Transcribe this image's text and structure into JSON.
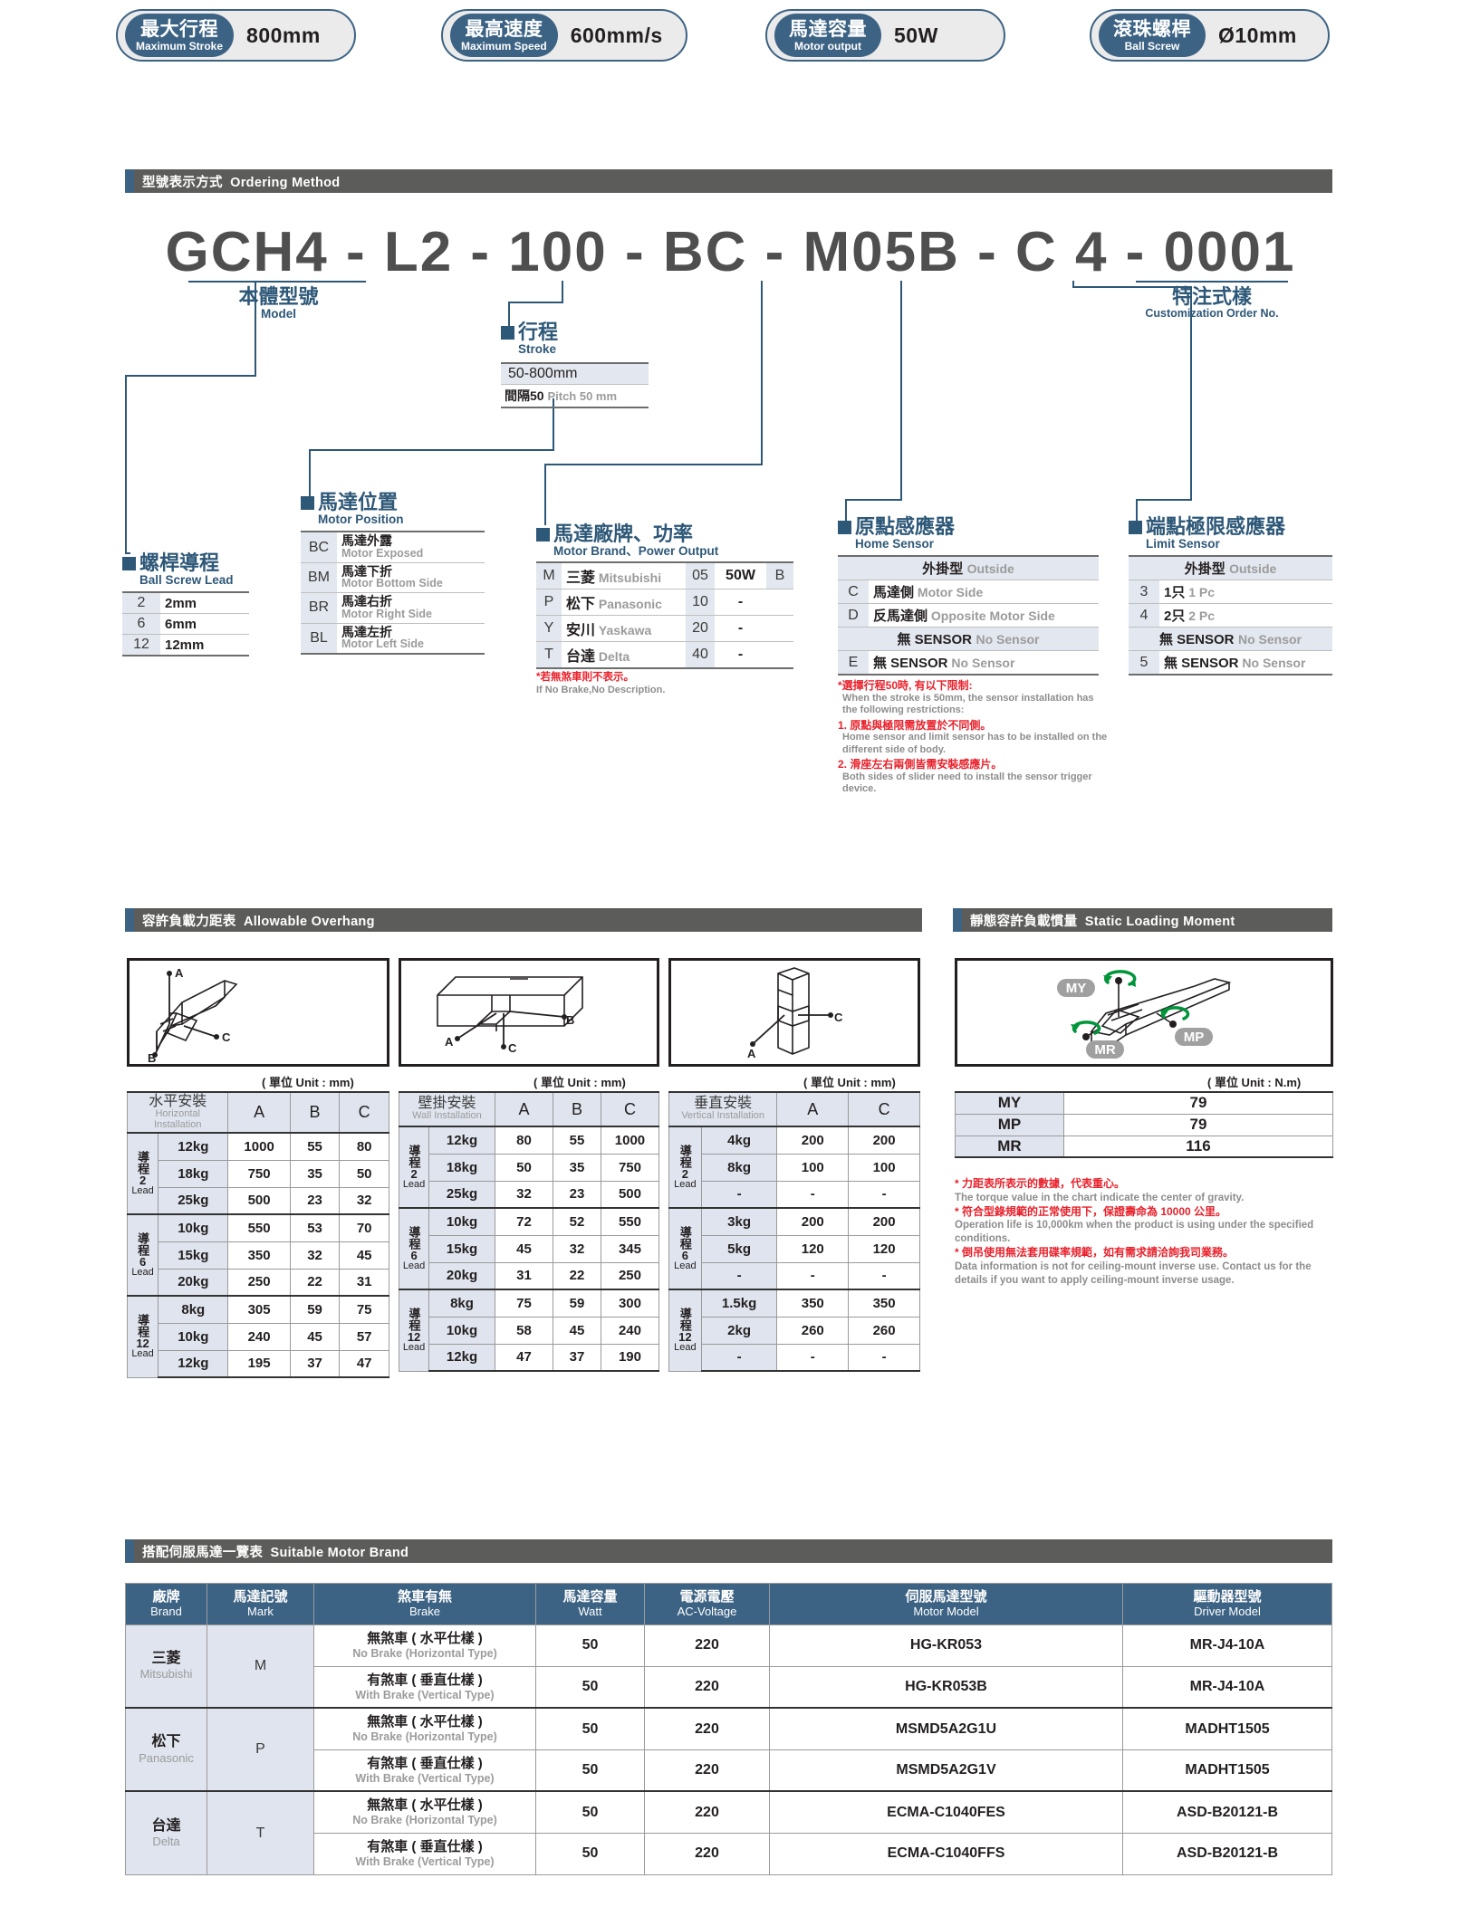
{
  "badges": [
    {
      "cn": "最大行程",
      "en": "Maximum Stroke",
      "value": "800mm"
    },
    {
      "cn": "最高速度",
      "en": "Maximum Speed",
      "value": "600mm/s"
    },
    {
      "cn": "馬達容量",
      "en": "Motor output",
      "value": "50W"
    },
    {
      "cn": "滾珠螺桿",
      "en": "Ball Screw",
      "value": "Ø10mm"
    }
  ],
  "sections": {
    "ordering": {
      "cn": "型號表示方式",
      "en": "Ordering Method"
    },
    "overhang": {
      "cn": "容許負載力距表",
      "en": "Allowable Overhang"
    },
    "moment": {
      "cn": "靜態容許負載慣量",
      "en": "Static Loading Moment"
    },
    "motorbrand": {
      "cn": "搭配伺服馬達一覽表",
      "en": "Suitable Motor Brand"
    }
  },
  "order_code": "GCH4 - L2 - 100 - BC - M05B - C 4 - 0001",
  "callouts": {
    "model": {
      "cn": "本體型號",
      "en": "Model"
    },
    "custom": {
      "cn": "特注式樣",
      "en": "Customization Order No."
    },
    "lead": {
      "cn": "螺桿導程",
      "en": "Ball Screw Lead",
      "rows": [
        [
          "2",
          "2mm"
        ],
        [
          "6",
          "6mm"
        ],
        [
          "12",
          "12mm"
        ]
      ]
    },
    "motor_position": {
      "cn": "馬達位置",
      "en": "Motor Position",
      "rows": [
        {
          "key": "BC",
          "cn": "馬達外露",
          "en": "Motor Exposed"
        },
        {
          "key": "BM",
          "cn": "馬達下折",
          "en": "Motor Bottom Side"
        },
        {
          "key": "BR",
          "cn": "馬達右折",
          "en": "Motor Right Side"
        },
        {
          "key": "BL",
          "cn": "馬達左折",
          "en": "Motor Left Side"
        }
      ]
    },
    "stroke": {
      "cn": "行程",
      "en": "Stroke",
      "range": "50-800mm",
      "pitch_cn": "間隔50",
      "pitch_en": "Pitch 50 mm"
    },
    "motor_brand": {
      "cn": "馬達廠牌、功率",
      "en": "Motor Brand、Power Output",
      "rows": [
        {
          "mark": "M",
          "cn": "三菱",
          "en": "Mitsubishi",
          "code": "05",
          "watt": "50W",
          "brake": "B"
        },
        {
          "mark": "P",
          "cn": "松下",
          "en": "Panasonic",
          "code": "10",
          "watt": "-",
          "brake": ""
        },
        {
          "mark": "Y",
          "cn": "安川",
          "en": "Yaskawa",
          "code": "20",
          "watt": "-",
          "brake": ""
        },
        {
          "mark": "T",
          "cn": "台達",
          "en": "Delta",
          "code": "40",
          "watt": "-",
          "brake": ""
        }
      ],
      "note_cn": "*若無煞車則不表示。",
      "note_en": "If No Brake,No Description."
    },
    "home_sensor": {
      "cn": "原點感應器",
      "en": "Home Sensor",
      "group1_cn": "外掛型",
      "group1_en": "Outside",
      "rows": [
        {
          "key": "C",
          "cn": "馬達側",
          "en": "Motor Side"
        },
        {
          "key": "D",
          "cn": "反馬達側",
          "en": "Opposite Motor Side"
        }
      ],
      "group2_cn": "無 SENSOR",
      "group2_en": "No Sensor",
      "rows2": [
        {
          "key": "E",
          "cn": "無 SENSOR",
          "en": "No Sensor"
        }
      ],
      "notes": [
        {
          "cn": "*選擇行程50時, 有以下限制:",
          "en": "When the stroke is 50mm, the sensor installation has the following restrictions:"
        },
        {
          "cn": "1. 原點與極限需放置於不同側。",
          "en": "Home sensor and limit sensor has to be installed on the different side of body."
        },
        {
          "cn": "2. 滑座左右兩側皆需安裝感應片。",
          "en": "Both sides of slider need to install the sensor trigger device."
        }
      ]
    },
    "limit_sensor": {
      "cn": "端點極限感應器",
      "en": "Limit Sensor",
      "group1_cn": "外掛型",
      "group1_en": "Outside",
      "rows": [
        {
          "key": "3",
          "cn": "1只",
          "en": "1 Pc"
        },
        {
          "key": "4",
          "cn": "2只",
          "en": "2 Pc"
        }
      ],
      "group2_cn": "無 SENSOR",
      "group2_en": "No Sensor",
      "rows2": [
        {
          "key": "5",
          "cn": "無 SENSOR",
          "en": "No Sensor"
        }
      ]
    }
  },
  "overhang": {
    "unit_mm": "( 單位 Unit : mm)",
    "unit_nm": "( 單位 Unit : N.m)",
    "diagram_labels": [
      "A",
      "B",
      "C"
    ],
    "tables": [
      {
        "cn": "水平安裝",
        "en": "Horizontal Installation",
        "cols": [
          "A",
          "B",
          "C"
        ],
        "groups": [
          {
            "lead_cn": "導程",
            "lead_num": "2",
            "lead_en": "Lead",
            "rows": [
              [
                "12kg",
                "1000",
                "55",
                "80"
              ],
              [
                "18kg",
                "750",
                "35",
                "50"
              ],
              [
                "25kg",
                "500",
                "23",
                "32"
              ]
            ]
          },
          {
            "lead_cn": "導程",
            "lead_num": "6",
            "lead_en": "Lead",
            "rows": [
              [
                "10kg",
                "550",
                "53",
                "70"
              ],
              [
                "15kg",
                "350",
                "32",
                "45"
              ],
              [
                "20kg",
                "250",
                "22",
                "31"
              ]
            ]
          },
          {
            "lead_cn": "導程",
            "lead_num": "12",
            "lead_en": "Lead",
            "rows": [
              [
                "8kg",
                "305",
                "59",
                "75"
              ],
              [
                "10kg",
                "240",
                "45",
                "57"
              ],
              [
                "12kg",
                "195",
                "37",
                "47"
              ]
            ]
          }
        ]
      },
      {
        "cn": "壁掛安裝",
        "en": "Wall Installation",
        "cols": [
          "A",
          "B",
          "C"
        ],
        "groups": [
          {
            "lead_cn": "導程",
            "lead_num": "2",
            "lead_en": "Lead",
            "rows": [
              [
                "12kg",
                "80",
                "55",
                "1000"
              ],
              [
                "18kg",
                "50",
                "35",
                "750"
              ],
              [
                "25kg",
                "32",
                "23",
                "500"
              ]
            ]
          },
          {
            "lead_cn": "導程",
            "lead_num": "6",
            "lead_en": "Lead",
            "rows": [
              [
                "10kg",
                "72",
                "52",
                "550"
              ],
              [
                "15kg",
                "45",
                "32",
                "345"
              ],
              [
                "20kg",
                "31",
                "22",
                "250"
              ]
            ]
          },
          {
            "lead_cn": "導程",
            "lead_num": "12",
            "lead_en": "Lead",
            "rows": [
              [
                "8kg",
                "75",
                "59",
                "300"
              ],
              [
                "10kg",
                "58",
                "45",
                "240"
              ],
              [
                "12kg",
                "47",
                "37",
                "190"
              ]
            ]
          }
        ]
      },
      {
        "cn": "垂直安裝",
        "en": "Vertical Installation",
        "cols": [
          "A",
          "C"
        ],
        "groups": [
          {
            "lead_cn": "導程",
            "lead_num": "2",
            "lead_en": "Lead",
            "rows": [
              [
                "4kg",
                "200",
                "200"
              ],
              [
                "8kg",
                "100",
                "100"
              ],
              [
                "-",
                "-",
                "-"
              ]
            ]
          },
          {
            "lead_cn": "導程",
            "lead_num": "6",
            "lead_en": "Lead",
            "rows": [
              [
                "3kg",
                "200",
                "200"
              ],
              [
                "5kg",
                "120",
                "120"
              ],
              [
                "-",
                "-",
                "-"
              ]
            ]
          },
          {
            "lead_cn": "導程",
            "lead_num": "12",
            "lead_en": "Lead",
            "rows": [
              [
                "1.5kg",
                "350",
                "350"
              ],
              [
                "2kg",
                "260",
                "260"
              ],
              [
                "-",
                "-",
                "-"
              ]
            ]
          }
        ]
      }
    ]
  },
  "moment": {
    "diagram_labels": [
      "MY",
      "MP",
      "MR"
    ],
    "rows": [
      [
        "MY",
        "79"
      ],
      [
        "MP",
        "79"
      ],
      [
        "MR",
        "116"
      ]
    ],
    "notes": [
      {
        "cn": "* 力距表所表示的數據，代表重心。",
        "en": "The torque value in the chart indicate the center of gravity."
      },
      {
        "cn": "* 符合型錄規範的正常使用下，保證壽命為 10000 公里。",
        "en": "Operation life is 10,000km when the product is using under the specified conditions."
      },
      {
        "cn": "* 倒吊使用無法套用碟率規範，如有需求請洽詢我司業務。",
        "en": "Data information is not for ceiling-mount inverse use. Contact us for the details if you want to apply ceiling-mount inverse usage."
      }
    ]
  },
  "motor_table": {
    "headers": [
      {
        "cn": "廠牌",
        "en": "Brand"
      },
      {
        "cn": "馬達記號",
        "en": "Mark"
      },
      {
        "cn": "煞車有無",
        "en": "Brake"
      },
      {
        "cn": "馬達容量",
        "en": "Watt"
      },
      {
        "cn": "電源電壓",
        "en": "AC-Voltage"
      },
      {
        "cn": "伺服馬達型號",
        "en": "Motor Model"
      },
      {
        "cn": "驅動器型號",
        "en": "Driver Model"
      }
    ],
    "brands": [
      {
        "cn": "三菱",
        "en": "Mitsubishi",
        "mark": "M",
        "rows": [
          {
            "brake_cn": "無煞車 ( 水平仕樣 )",
            "brake_en": "No Brake (Horizontal Type)",
            "watt": "50",
            "volt": "220",
            "motor": "HG-KR053",
            "driver": "MR-J4-10A"
          },
          {
            "brake_cn": "有煞車 ( 垂直仕樣 )",
            "brake_en": "With Brake (Vertical Type)",
            "watt": "50",
            "volt": "220",
            "motor": "HG-KR053B",
            "driver": "MR-J4-10A"
          }
        ]
      },
      {
        "cn": "松下",
        "en": "Panasonic",
        "mark": "P",
        "rows": [
          {
            "brake_cn": "無煞車 ( 水平仕樣 )",
            "brake_en": "No Brake (Horizontal Type)",
            "watt": "50",
            "volt": "220",
            "motor": "MSMD5A2G1U",
            "driver": "MADHT1505"
          },
          {
            "brake_cn": "有煞車 ( 垂直仕樣 )",
            "brake_en": "With Brake (Vertical Type)",
            "watt": "50",
            "volt": "220",
            "motor": "MSMD5A2G1V",
            "driver": "MADHT1505"
          }
        ]
      },
      {
        "cn": "台達",
        "en": "Delta",
        "mark": "T",
        "rows": [
          {
            "brake_cn": "無煞車 ( 水平仕樣 )",
            "brake_en": "No Brake (Horizontal Type)",
            "watt": "50",
            "volt": "220",
            "motor": "ECMA-C1040FES",
            "driver": "ASD-B20121-B"
          },
          {
            "brake_cn": "有煞車 ( 垂直仕樣 )",
            "brake_en": "With Brake (Vertical Type)",
            "watt": "50",
            "volt": "220",
            "motor": "ECMA-C1040FFS",
            "driver": "ASD-B20121-B"
          }
        ]
      }
    ]
  },
  "colors": {
    "accent": "#3d6384",
    "bar": "#5c5c5a",
    "red": "#e8212b",
    "gray": "#9b9b9b",
    "tablehead": "#dfe4ee"
  }
}
